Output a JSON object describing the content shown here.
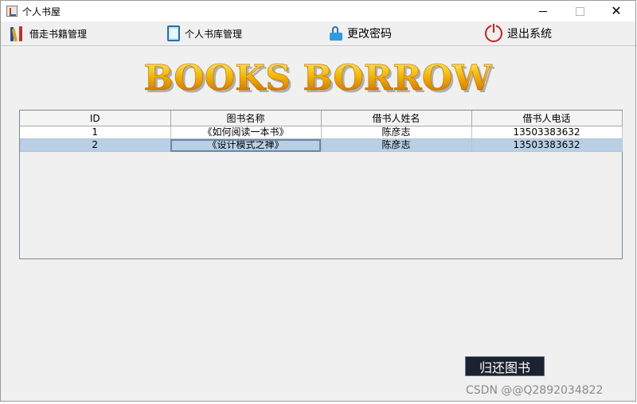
{
  "window": {
    "title": "个人书屋"
  },
  "menu": [
    {
      "label": "借走书籍管理",
      "icon": "books-icon"
    },
    {
      "label": "个人书库管理",
      "icon": "library-icon"
    },
    {
      "label": "更改密码",
      "icon": "lock-icon"
    },
    {
      "label": "退出系统",
      "icon": "power-icon"
    }
  ],
  "banner": {
    "text": "BOOKS BORROW"
  },
  "table": {
    "columns": [
      "ID",
      "图书名称",
      "借书人姓名",
      "借书人电话"
    ],
    "rows": [
      [
        "1",
        "《如何阅读一本书》",
        "陈彦志",
        "13503383632"
      ],
      [
        "2",
        "《设计模式之禅》",
        "陈彦志",
        "13503383632"
      ]
    ],
    "selected_row": 2
  },
  "actions": {
    "return_button": "归还图书"
  },
  "watermark": "CSDN @@Q2892034822",
  "colors": {
    "selection": "#b8cfe5",
    "button_bg": "#1b2330",
    "banner_gold": "#f5a800",
    "power_red": "#cc1e1e"
  }
}
